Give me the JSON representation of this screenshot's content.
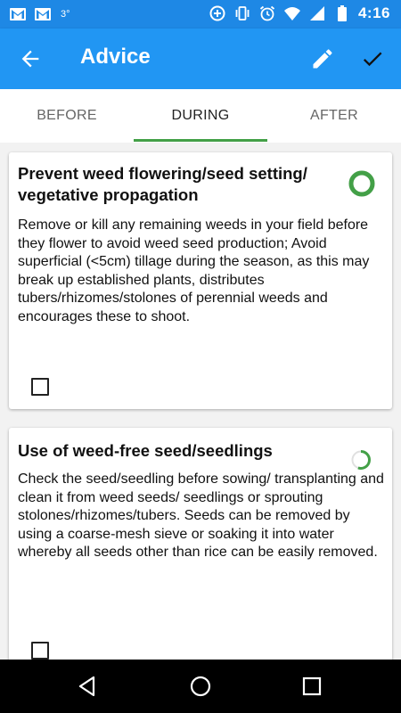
{
  "status_bar": {
    "notification_icons": [
      "gmail-icon",
      "gmail-icon"
    ],
    "temperature": "3°",
    "status_icons": [
      "data-saver-icon",
      "vibrate-icon",
      "alarm-icon",
      "wifi-icon",
      "signal-icon",
      "battery-icon"
    ],
    "time": "4:16"
  },
  "app_bar": {
    "title": "Advice",
    "back_icon": "arrow-back-icon",
    "edit_icon": "pencil-icon",
    "confirm_icon": "check-icon"
  },
  "tabs": [
    {
      "label": "BEFORE",
      "active": false
    },
    {
      "label": "DURING",
      "active": true
    },
    {
      "label": "AFTER",
      "active": false
    }
  ],
  "colors": {
    "status_bar": "#1e88e5",
    "app_bar": "#2196f3",
    "accent": "#43a047",
    "progress_track": "#e0e0e0"
  },
  "cards": [
    {
      "title": "Prevent weed flowering/seed setting/ vegetative propagation",
      "body": "Remove or kill any remaining weeds in your field before they flower to avoid weed seed production; Avoid superficial (<5cm) tillage during the season, as this may break up established plants, distributes tubers/rhizomes/stolones of perennial weeds and encourages these to shoot.",
      "progress": 1.0,
      "checked": false
    },
    {
      "title": "Use of weed-free seed/seedlings",
      "body": "Check the seed/seedling before sowing/ transplanting and clean it from weed seeds/ seedlings or sprouting stolones/rhizomes/tubers. Seeds can be removed by using a coarse-mesh sieve or soaking it into water whereby all seeds other than rice can be easily removed.",
      "progress": 0.55,
      "checked": false
    }
  ],
  "nav_bar": {
    "back": "nav-back-icon",
    "home": "nav-home-icon",
    "recents": "nav-recents-icon"
  }
}
